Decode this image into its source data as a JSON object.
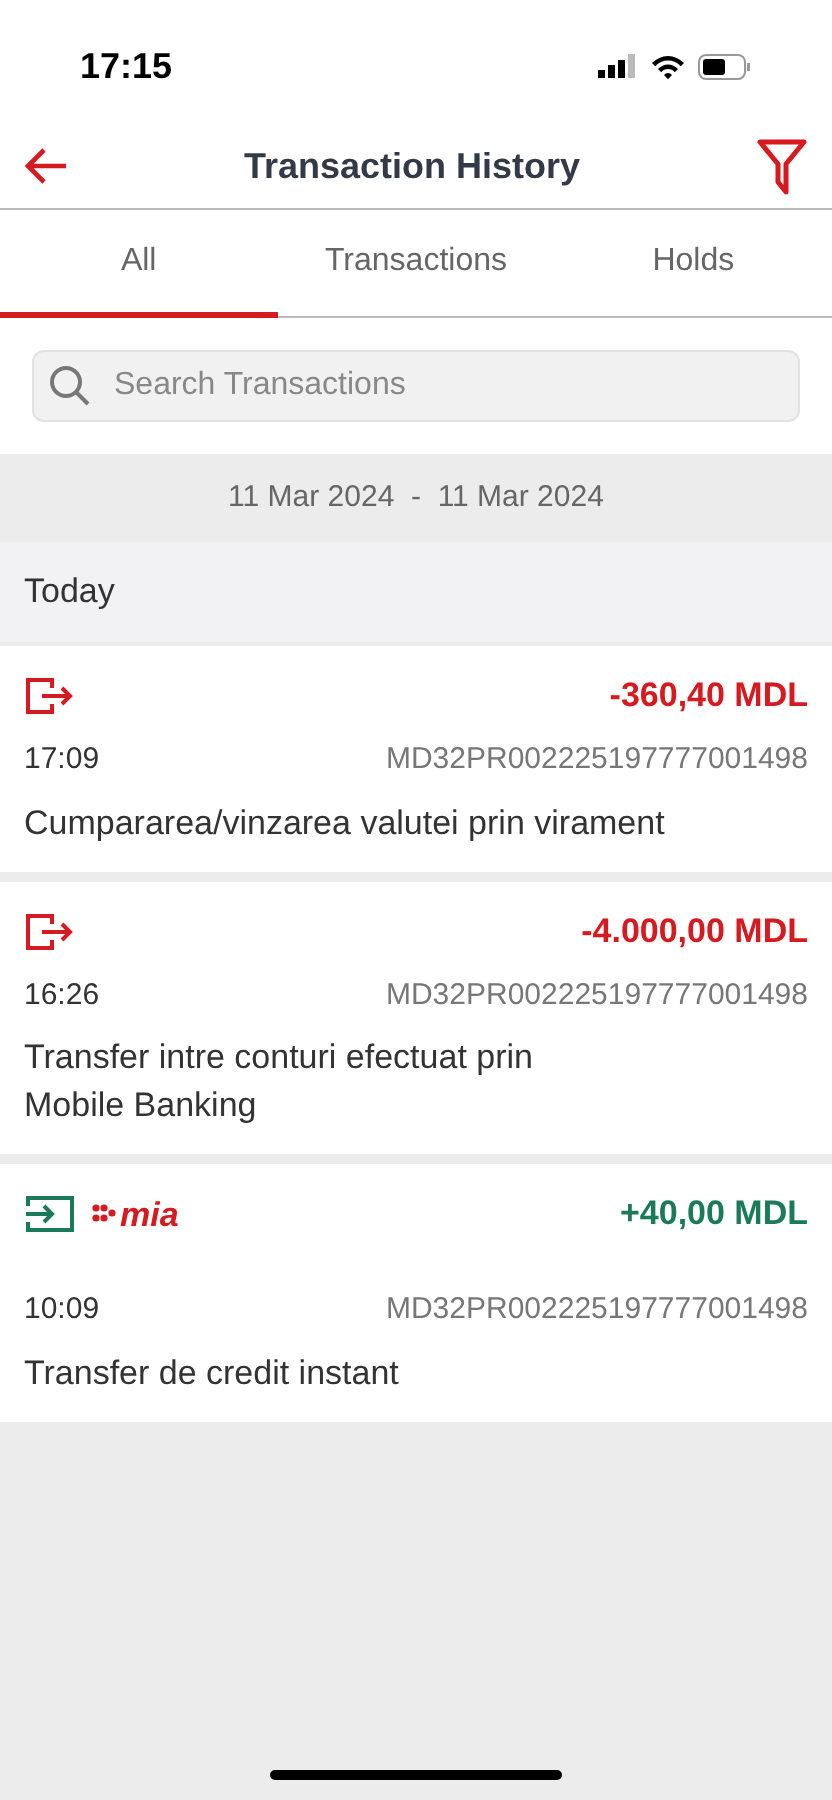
{
  "status_bar": {
    "time": "17:15"
  },
  "header": {
    "title": "Transaction History"
  },
  "tabs": [
    {
      "label": "All",
      "selected": true
    },
    {
      "label": "Transactions",
      "selected": false
    },
    {
      "label": "Holds",
      "selected": false
    }
  ],
  "search": {
    "placeholder": "Search Transactions"
  },
  "date_range": "11 Mar 2024  -  11 Mar 2024",
  "section": "Today",
  "transactions": [
    {
      "kind": "outgoing",
      "amount": "-360,40 MDL",
      "time": "17:09",
      "account": "MD32PR002225197777001498",
      "description": "Cumpararea/vinzarea valutei prin virament"
    },
    {
      "kind": "outgoing",
      "amount": "-4.000,00 MDL",
      "time": "16:26",
      "account": "MD32PR002225197777001498",
      "description": "Transfer intre conturi efectuat prin\nMobile Banking"
    },
    {
      "kind": "incoming",
      "badge": "mia",
      "amount": "+40,00 MDL",
      "time": "10:09",
      "account": "MD32PR002225197777001498",
      "description": "Transfer de credit instant"
    }
  ]
}
